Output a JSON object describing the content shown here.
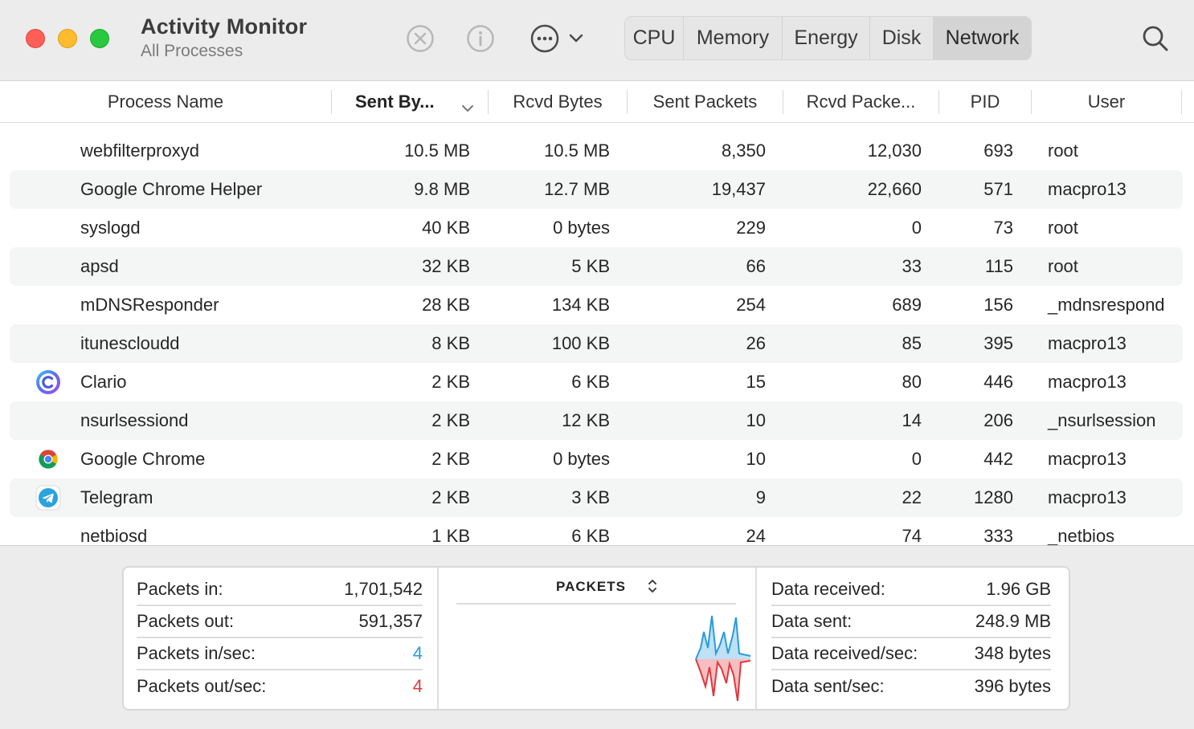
{
  "window": {
    "title": "Activity Monitor",
    "subtitle": "All Processes"
  },
  "toolbar": {
    "icons": [
      "stop-process-icon",
      "info-icon",
      "more-actions-icon",
      "chevron-down-icon",
      "search-icon"
    ],
    "tabs": [
      {
        "label": "CPU",
        "active": false
      },
      {
        "label": "Memory",
        "active": false
      },
      {
        "label": "Energy",
        "active": false
      },
      {
        "label": "Disk",
        "active": false
      },
      {
        "label": "Network",
        "active": true
      }
    ]
  },
  "table": {
    "columns": [
      "Process Name",
      "Sent By...",
      "Rcvd Bytes",
      "Sent Packets",
      "Rcvd Packe...",
      "PID",
      "User"
    ],
    "sorted_column": "Sent By...",
    "rows": [
      {
        "name": "webfilterproxyd",
        "icon": "",
        "sent": "10.5 MB",
        "rcvd": "10.5 MB",
        "sent_packets": "8,350",
        "rcvd_packets": "12,030",
        "pid": "693",
        "user": "root"
      },
      {
        "name": "Google Chrome Helper",
        "icon": "",
        "sent": "9.8 MB",
        "rcvd": "12.7 MB",
        "sent_packets": "19,437",
        "rcvd_packets": "22,660",
        "pid": "571",
        "user": "macpro13"
      },
      {
        "name": "syslogd",
        "icon": "",
        "sent": "40 KB",
        "rcvd": "0 bytes",
        "sent_packets": "229",
        "rcvd_packets": "0",
        "pid": "73",
        "user": "root"
      },
      {
        "name": "apsd",
        "icon": "",
        "sent": "32 KB",
        "rcvd": "5 KB",
        "sent_packets": "66",
        "rcvd_packets": "33",
        "pid": "115",
        "user": "root"
      },
      {
        "name": "mDNSResponder",
        "icon": "",
        "sent": "28 KB",
        "rcvd": "134 KB",
        "sent_packets": "254",
        "rcvd_packets": "689",
        "pid": "156",
        "user": "_mdnsrespond"
      },
      {
        "name": "itunescloudd",
        "icon": "",
        "sent": "8 KB",
        "rcvd": "100 KB",
        "sent_packets": "26",
        "rcvd_packets": "85",
        "pid": "395",
        "user": "macpro13"
      },
      {
        "name": "Clario",
        "icon": "clario-app-icon",
        "sent": "2 KB",
        "rcvd": "6 KB",
        "sent_packets": "15",
        "rcvd_packets": "80",
        "pid": "446",
        "user": "macpro13"
      },
      {
        "name": "nsurlsessiond",
        "icon": "",
        "sent": "2 KB",
        "rcvd": "12 KB",
        "sent_packets": "10",
        "rcvd_packets": "14",
        "pid": "206",
        "user": "_nsurlsession"
      },
      {
        "name": "Google Chrome",
        "icon": "chrome-app-icon",
        "sent": "2 KB",
        "rcvd": "0 bytes",
        "sent_packets": "10",
        "rcvd_packets": "0",
        "pid": "442",
        "user": "macpro13"
      },
      {
        "name": "Telegram",
        "icon": "telegram-app-icon",
        "sent": "2 KB",
        "rcvd": "3 KB",
        "sent_packets": "9",
        "rcvd_packets": "22",
        "pid": "1280",
        "user": "macpro13"
      },
      {
        "name": "netbiosd",
        "icon": "",
        "sent": "1 KB",
        "rcvd": "6 KB",
        "sent_packets": "24",
        "rcvd_packets": "74",
        "pid": "333",
        "user": "_netbios"
      }
    ]
  },
  "summary": {
    "packets": [
      {
        "label": "Packets in:",
        "value": "1,701,542"
      },
      {
        "label": "Packets out:",
        "value": "591,357"
      },
      {
        "label": "Packets in/sec:",
        "value": "4"
      },
      {
        "label": "Packets out/sec:",
        "value": "4"
      }
    ],
    "chart_title": "PACKETS",
    "data": [
      {
        "label": "Data received:",
        "value": "1.96 GB"
      },
      {
        "label": "Data sent:",
        "value": "248.9 MB"
      },
      {
        "label": "Data received/sec:",
        "value": "348 bytes"
      },
      {
        "label": "Data sent/sec:",
        "value": "396 bytes"
      }
    ]
  },
  "colors": {
    "packets_in": "#2a9bdc",
    "packets_out": "#e0383e"
  }
}
